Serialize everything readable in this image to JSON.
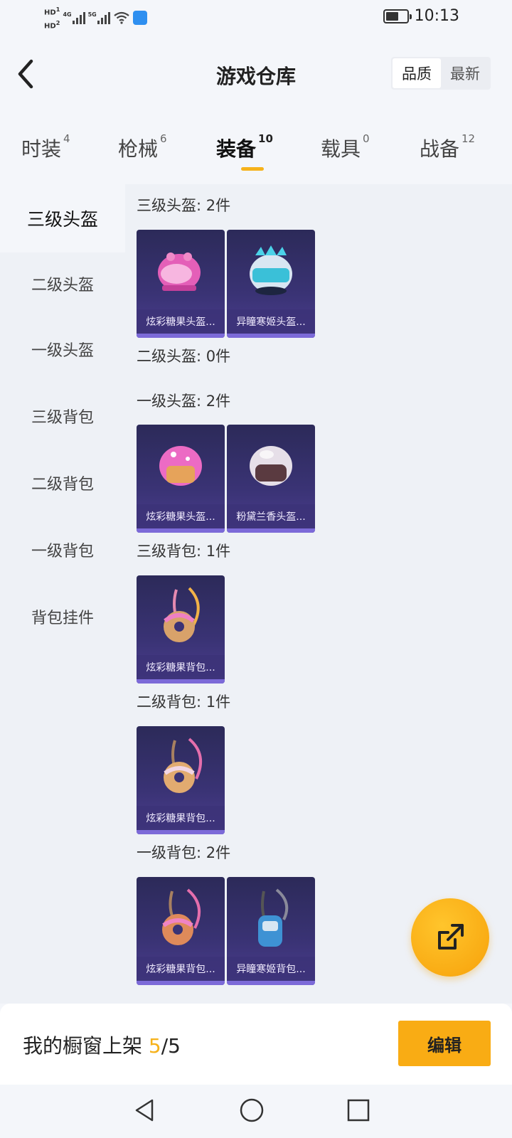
{
  "status_bar": {
    "hd1": "HD",
    "hd1_sub": "1",
    "hd2": "HD",
    "hd2_sub": "2",
    "net1": "4G",
    "net2": "5G",
    "time": "10:13",
    "battery_level": 0.6
  },
  "header": {
    "title": "游戏仓库",
    "sort_options": [
      "品质",
      "最新"
    ],
    "sort_active": "品质"
  },
  "tabs": [
    {
      "label": "时装",
      "count": "4"
    },
    {
      "label": "枪械",
      "count": "6"
    },
    {
      "label": "装备",
      "count": "10",
      "active": true
    },
    {
      "label": "载具",
      "count": "0"
    },
    {
      "label": "战备",
      "count": "12"
    }
  ],
  "sidebar": {
    "items": [
      {
        "label": "三级头盔",
        "active": true
      },
      {
        "label": "二级头盔"
      },
      {
        "label": "一级头盔"
      },
      {
        "label": "三级背包"
      },
      {
        "label": "二级背包"
      },
      {
        "label": "一级背包"
      },
      {
        "label": "背包挂件"
      }
    ]
  },
  "groups": [
    {
      "title": "三级头盔: 2件",
      "items": [
        {
          "name": "炫彩糖果头盔...",
          "icon": "pink-candy-helmet-icon"
        },
        {
          "name": "异瞳寒姬头盔...",
          "icon": "ice-princess-helmet-icon"
        }
      ]
    },
    {
      "title": "二级头盔: 0件",
      "items": []
    },
    {
      "title": "一级头盔: 2件",
      "items": [
        {
          "name": "炫彩糖果头盔...",
          "icon": "pink-candy-helmet-icon"
        },
        {
          "name": "粉黛兰香头盔...",
          "icon": "pearl-helmet-icon"
        }
      ]
    },
    {
      "title": "三级背包: 1件",
      "items": [
        {
          "name": "炫彩糖果背包...",
          "icon": "donut-backpack-icon"
        }
      ]
    },
    {
      "title": "二级背包: 1件",
      "items": [
        {
          "name": "炫彩糖果背包...",
          "icon": "donut-backpack-icon"
        }
      ]
    },
    {
      "title": "一级背包: 2件",
      "items": [
        {
          "name": "炫彩糖果背包...",
          "icon": "donut-backpack-icon"
        },
        {
          "name": "异瞳寒姬背包...",
          "icon": "ice-princess-backpack-icon"
        }
      ]
    }
  ],
  "bottom": {
    "shelf_label": "我的橱窗上架 ",
    "shelf_current": "5",
    "shelf_total": "/5",
    "edit_label": "编辑"
  },
  "colors": {
    "accent": "#f6b21b",
    "card_bg": "#3a3375",
    "fab": "#f7a10a"
  }
}
